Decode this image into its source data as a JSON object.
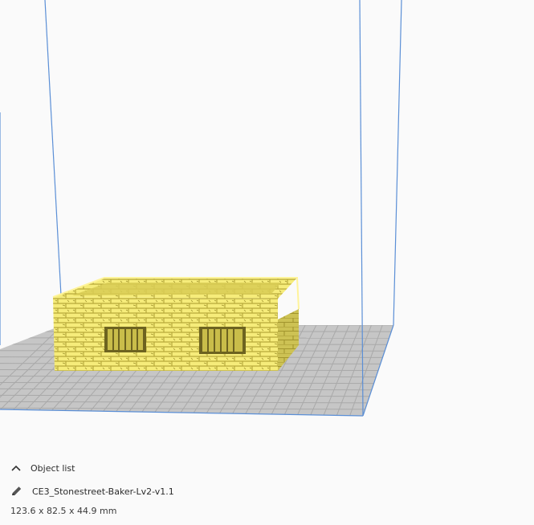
{
  "object_list": {
    "label": "Object list",
    "icon": "chevron-up-icon"
  },
  "object": {
    "name": "CE3_Stonestreet-Baker-Lv2-v1.1",
    "icon": "pencil-icon",
    "dimensions": "123.6 x 82.5 x 44.9 mm"
  },
  "colors": {
    "model": "#f6ec7a",
    "model_shadow": "#d9cd55",
    "build_plate": "#c6c6c6",
    "grid_line": "#a9a9a9",
    "volume_edge": "#5b8fd6"
  }
}
